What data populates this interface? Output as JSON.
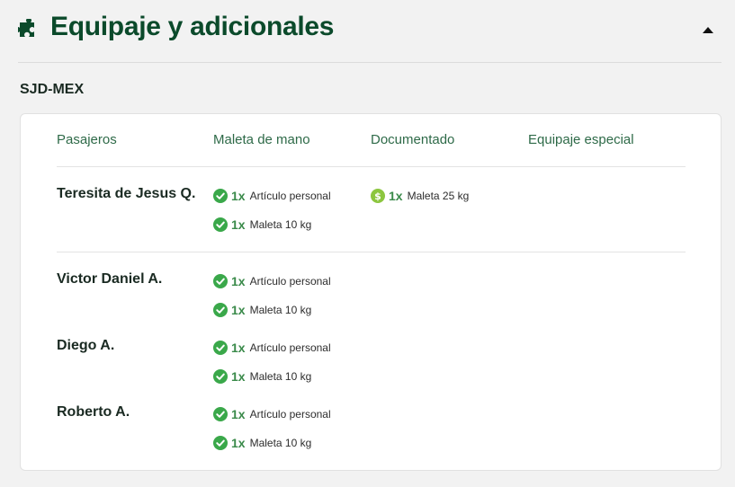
{
  "header": {
    "title": "Equipaje y adicionales",
    "icon": "puzzle-icon",
    "collapse_icon": "caret-up-icon"
  },
  "route": "SJD-MEX",
  "columns": [
    "Pasajeros",
    "Maleta de mano",
    "Documentado",
    "Equipaje especial"
  ],
  "passengers": [
    {
      "name": "Teresita de Jesus Q.",
      "carry_on": [
        {
          "qty": "1x",
          "desc": "Artículo personal",
          "icon": "check-circle-icon"
        },
        {
          "qty": "1x",
          "desc": "Maleta 10 kg",
          "icon": "check-circle-icon"
        }
      ],
      "checked": [
        {
          "qty": "1x",
          "desc": "Maleta 25 kg",
          "icon": "dollar-circle-icon"
        }
      ]
    },
    {
      "name": "Victor Daniel A.",
      "carry_on": [
        {
          "qty": "1x",
          "desc": "Artículo personal",
          "icon": "check-circle-icon"
        },
        {
          "qty": "1x",
          "desc": "Maleta 10 kg",
          "icon": "check-circle-icon"
        }
      ]
    },
    {
      "name": "Diego A.",
      "carry_on": [
        {
          "qty": "1x",
          "desc": "Artículo personal",
          "icon": "check-circle-icon"
        },
        {
          "qty": "1x",
          "desc": "Maleta 10 kg",
          "icon": "check-circle-icon"
        }
      ]
    },
    {
      "name": "Roberto A.",
      "carry_on": [
        {
          "qty": "1x",
          "desc": "Artículo personal",
          "icon": "check-circle-icon"
        },
        {
          "qty": "1x",
          "desc": "Maleta 10 kg",
          "icon": "check-circle-icon"
        }
      ]
    }
  ],
  "colors": {
    "title": "#0b4a2b",
    "column_header": "#2e6a48",
    "check": "#3aa84a",
    "paid": "#8cc63f"
  }
}
